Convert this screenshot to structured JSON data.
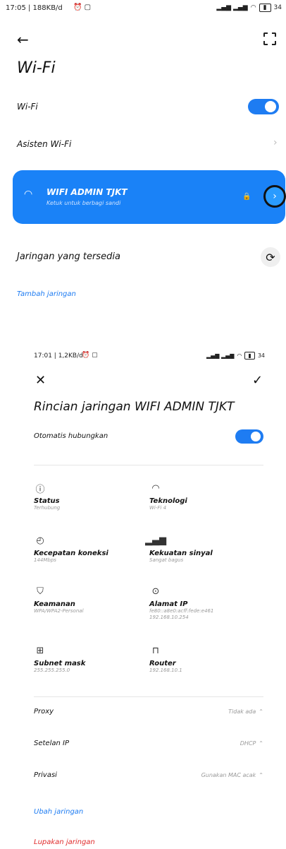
{
  "status_bar": {
    "left": "17:05 | 188KB/d",
    "right": "34"
  },
  "top": {
    "title": "Wi-Fi",
    "wifi_label": "Wi-Fi",
    "assistant_label": "Asisten Wi-Fi",
    "connected_ssid": "WIFI ADMIN TJKT",
    "connected_sub": "Ketuk untuk berbagi sandi",
    "available_label": "Jaringan yang tersedia",
    "add_network": "Tambah jaringan"
  },
  "status_bar2": {
    "left": "17:01 | 1,2KB/d",
    "right": "34"
  },
  "detail": {
    "title": "Rincian jaringan WIFI ADMIN TJKT",
    "auto_connect": "Otomatis hubungkan",
    "items": [
      {
        "title": "Status",
        "value": "Terhubung"
      },
      {
        "title": "Teknologi",
        "value": "Wi-Fi 4"
      },
      {
        "title": "Kecepatan koneksi",
        "value": "144Mbps"
      },
      {
        "title": "Kekuatan sinyal",
        "value": "Sangat bagus"
      },
      {
        "title": "Keamanan",
        "value": "WPA/WPA2-Personal"
      },
      {
        "title": "Alamat IP",
        "value": "fe80::a8e0:acff:fede:e461",
        "value2": "192.168.10.254"
      },
      {
        "title": "Subnet mask",
        "value": "255.255.255.0"
      },
      {
        "title": "Router",
        "value": "192.168.10.1"
      }
    ],
    "proxy_label": "Proxy",
    "proxy_value": "Tidak ada",
    "ip_label": "Setelan IP",
    "ip_value": "DHCP",
    "privacy_label": "Privasi",
    "privacy_value": "Gunakan MAC acak",
    "edit_network": "Ubah jaringan",
    "forget_network": "Lupakan jaringan"
  },
  "colors": {
    "accent": "#1e7cf2",
    "card": "#1a82f7",
    "danger": "#e02b2b"
  }
}
